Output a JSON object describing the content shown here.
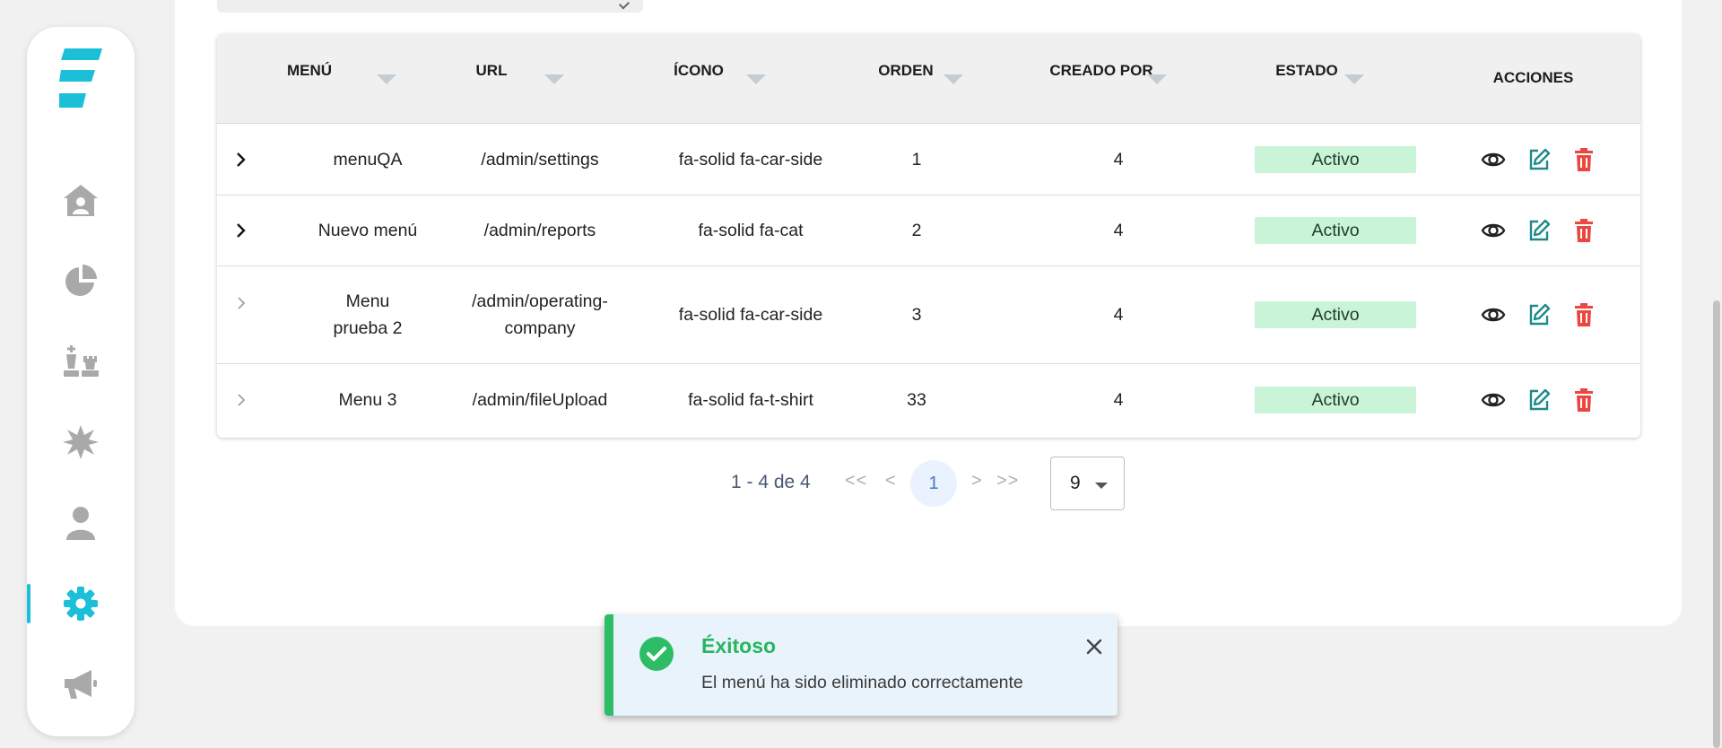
{
  "colors": {
    "accent": "#1bbfd8",
    "sidebar_icon": "#a9a9a9",
    "active_badge_bg": "#c9f4d8",
    "edit_icon": "#1f8a8a",
    "delete_icon": "#e9473f",
    "success": "#2ebd67"
  },
  "sidebar": {
    "logo": "brand-logo",
    "items": [
      {
        "name": "home",
        "icon": "home-icon",
        "active": false
      },
      {
        "name": "reports",
        "icon": "pie-chart-icon",
        "active": false
      },
      {
        "name": "strategy",
        "icon": "chess-icon",
        "active": false
      },
      {
        "name": "burst",
        "icon": "burst-icon",
        "active": false
      },
      {
        "name": "users",
        "icon": "user-icon",
        "active": false
      },
      {
        "name": "settings",
        "icon": "gear-icon",
        "active": true
      },
      {
        "name": "campaigns",
        "icon": "megaphone-icon",
        "active": false
      }
    ]
  },
  "table": {
    "headers": {
      "menu": "MENÚ",
      "url": "URL",
      "icon": "ÍCONO",
      "order": "ORDEN",
      "created_by": "CREADO POR",
      "status": "ESTADO",
      "actions": "ACCIONES"
    },
    "rows": [
      {
        "menu": "menuQA",
        "url": "/admin/settings",
        "icon": "fa-solid fa-car-side",
        "order": "1",
        "created_by": "4",
        "status": "Activo",
        "expandable": true
      },
      {
        "menu": "Nuevo menú",
        "url": "/admin/reports",
        "icon": "fa-solid fa-cat",
        "order": "2",
        "created_by": "4",
        "status": "Activo",
        "expandable": true
      },
      {
        "menu": "Menu prueba 2",
        "url": "/admin/operating-company",
        "icon": "fa-solid fa-car-side",
        "order": "3",
        "created_by": "4",
        "status": "Activo",
        "expandable": false
      },
      {
        "menu": "Menu 3",
        "url": "/admin/fileUpload",
        "icon": "fa-solid fa-t-shirt",
        "order": "33",
        "created_by": "4",
        "status": "Activo",
        "expandable": false
      }
    ],
    "action_icons": [
      "eye-icon",
      "edit-icon",
      "trash-icon"
    ]
  },
  "pagination": {
    "range": "1 - 4 de 4",
    "first": "<<",
    "prev": "<",
    "current_page": "1",
    "next": ">",
    "last": ">>",
    "page_size": "9"
  },
  "toast": {
    "title": "Éxitoso",
    "message": "El menú ha sido eliminado correctamente",
    "close": "close-icon"
  }
}
